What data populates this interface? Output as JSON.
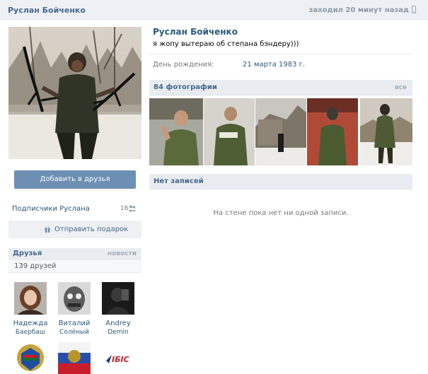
{
  "header": {
    "name": "Руслан Бойченко",
    "online": "заходил 20 минут назад"
  },
  "sidebar": {
    "add_friend": "Добавить в друзья",
    "subscribers_label": "Подписчики Руслана",
    "subscribers_count": "16",
    "gift_label": "Отправить подарок"
  },
  "friends": {
    "title": "Друзья",
    "news_link": "новости",
    "count": "139 друзей",
    "items": [
      {
        "first": "Надежда",
        "last": "Баербаш"
      },
      {
        "first": "Виталий",
        "last": "Солёный"
      },
      {
        "first": "Andrey",
        "last": "Demin"
      }
    ],
    "logo_text": "ІБІС"
  },
  "profile": {
    "name": "Руслан Бойченко",
    "status": "я жопу вытераю об степана бэндеру)))",
    "birthday_label": "День рождения:",
    "birthday_value": "21 марта 1983 г."
  },
  "photos": {
    "title": "84 фотографии",
    "all_link": "все"
  },
  "wall": {
    "title": "Нет записей",
    "empty_text": "На стене пока нет ни одной записи."
  },
  "colors": {
    "link": "#2b587a",
    "header_bg": "#edf1f5",
    "button": "#6d8fb3"
  }
}
